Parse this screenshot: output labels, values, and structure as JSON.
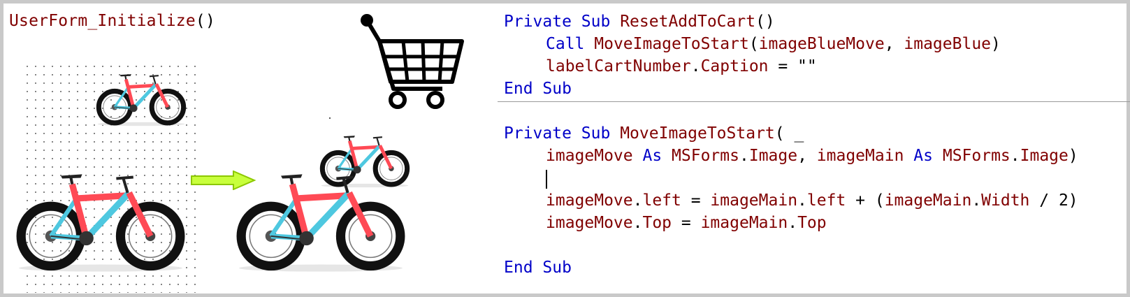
{
  "left_panel": {
    "title_name": "UserForm_Initialize",
    "title_parens": "()"
  },
  "icons": {
    "cart": "shopping-cart-icon",
    "arrow": "right-arrow-icon",
    "bike": "fat-tire-bicycle-image"
  },
  "colors": {
    "keyword": "#0000c8",
    "identifier": "#800000",
    "arrow_fill": "#c8ff3c",
    "arrow_stroke": "#8cc800",
    "bike_red": "#ff4a55",
    "bike_blue": "#4ec8e0"
  },
  "code": {
    "l1": {
      "kw1": "Private",
      "kw2": "Sub",
      "name": "ResetAddToCart",
      "rest": "()"
    },
    "l2": {
      "kw": "Call",
      "name": "MoveImageToStart",
      "p1": "(",
      "a1": "imageBlueMove",
      "p2": ", ",
      "a2": "imageBlue",
      "p3": ")"
    },
    "l3": {
      "obj": "labelCartNumber",
      "dot": ".",
      "prop": "Caption",
      "rest": " = \"\""
    },
    "l4": {
      "kw1": "End",
      "kw2": "Sub"
    },
    "l6": {
      "kw1": "Private",
      "kw2": "Sub",
      "name": "MoveImageToStart",
      "rest": "( _"
    },
    "l7": {
      "a1": "imageMove",
      "as1": "As",
      "t1": "MSForms",
      "d1": ".",
      "i1": "Image",
      "c": ", ",
      "a2": "imageMain",
      "as2": "As",
      "t2": "MSForms",
      "d2": ".",
      "i2": "Image",
      "close": ")"
    },
    "l9": {
      "o1": "imageMove",
      "d1": ".",
      "p1": "left",
      "eq": " = ",
      "o2": "imageMain",
      "d2": ".",
      "p2": "left",
      "plus": " + (",
      "o3": "imageMain",
      "d3": ".",
      "p3": "Width",
      "tail": " / 2)"
    },
    "l10": {
      "o1": "imageMove",
      "d1": ".",
      "p1": "Top",
      "eq": " = ",
      "o2": "imageMain",
      "d2": ".",
      "p2": "Top"
    },
    "l12": {
      "kw1": "End",
      "kw2": "Sub"
    }
  }
}
